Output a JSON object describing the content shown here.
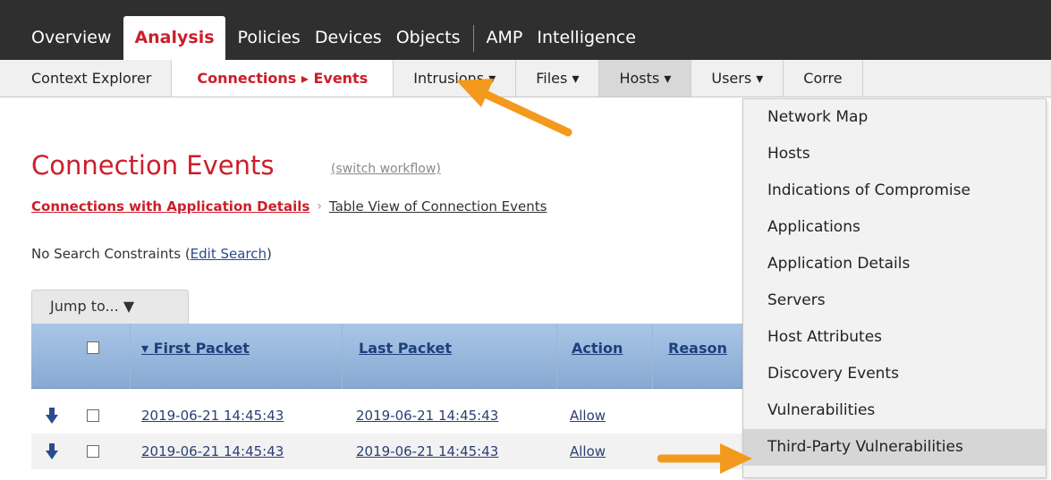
{
  "topnav": {
    "tabs": [
      {
        "label": "Overview"
      },
      {
        "label": "Analysis"
      },
      {
        "label": "Policies"
      },
      {
        "label": "Devices"
      },
      {
        "label": "Objects"
      },
      {
        "label": "AMP"
      },
      {
        "label": "Intelligence"
      }
    ]
  },
  "subnav": {
    "items": [
      {
        "label": "Context Explorer"
      },
      {
        "label": "Connections ▸ Events"
      },
      {
        "label": "Intrusions ▾"
      },
      {
        "label": "Files ▾"
      },
      {
        "label": "Hosts ▾"
      },
      {
        "label": "Users ▾"
      },
      {
        "label": "Corre"
      }
    ]
  },
  "page": {
    "title": "Connection Events",
    "switch_workflow": "(switch workflow)",
    "breadcrumb_active": "Connections with Application Details",
    "breadcrumb_sep": "›",
    "breadcrumb_next": "Table View of Connection Events",
    "constraints_prefix": "No Search Constraints (",
    "constraints_link": "Edit Search",
    "constraints_suffix": ")",
    "jump_label": "Jump to... ▼"
  },
  "table": {
    "columns": [
      "▾ First Packet",
      "Last Packet",
      "Action",
      "Reason"
    ],
    "rows": [
      {
        "first_packet": "2019-06-21 14:45:43",
        "last_packet": "2019-06-21 14:45:43",
        "action": "Allow"
      },
      {
        "first_packet": "2019-06-21 14:45:43",
        "last_packet": "2019-06-21 14:45:43",
        "action": "Allow"
      }
    ]
  },
  "hosts_menu": {
    "items": [
      {
        "label": "Network Map"
      },
      {
        "label": "Hosts"
      },
      {
        "label": "Indications of Compromise"
      },
      {
        "label": "Applications"
      },
      {
        "label": "Application Details"
      },
      {
        "label": "Servers"
      },
      {
        "label": "Host Attributes"
      },
      {
        "label": "Discovery Events"
      },
      {
        "label": "Vulnerabilities"
      },
      {
        "label": "Third-Party Vulnerabilities"
      }
    ]
  },
  "colors": {
    "accent_red": "#cc1e2a",
    "arrow_orange": "#f39a1e",
    "nav_dark": "#2f2f2f",
    "table_header_blue": "#a9c6e6"
  }
}
